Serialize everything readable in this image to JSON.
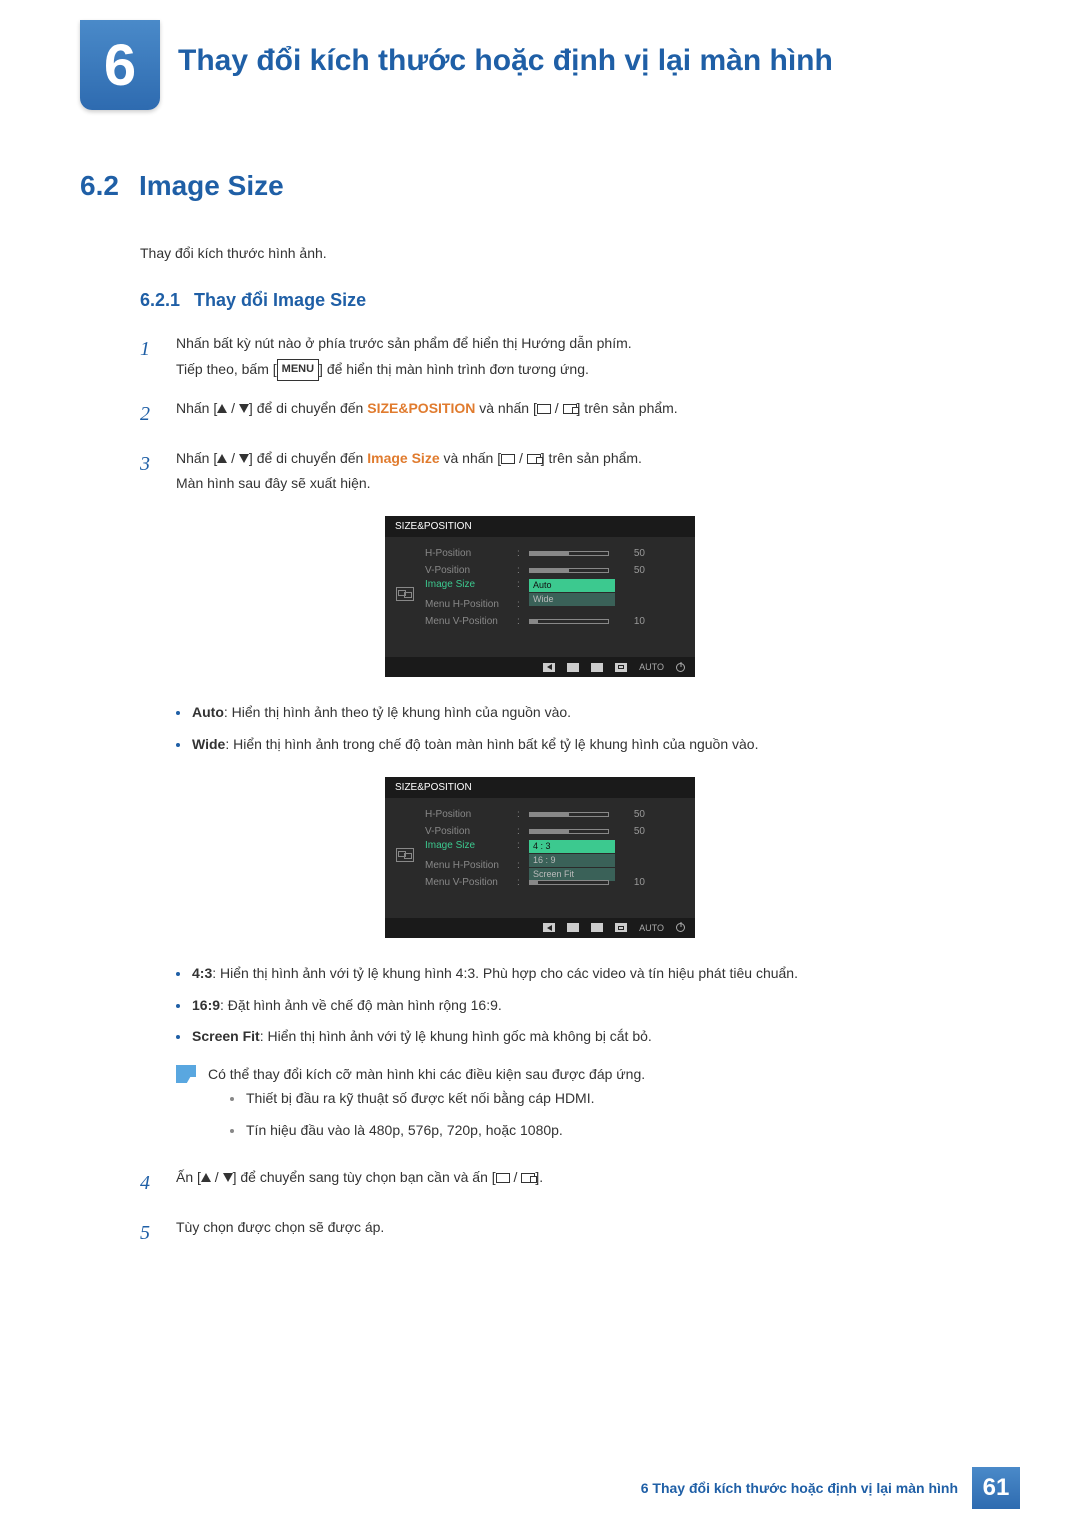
{
  "chapter": {
    "number": "6",
    "title": "Thay đổi kích thước hoặc định vị lại màn hình"
  },
  "section": {
    "number": "6.2",
    "title": "Image Size",
    "intro": "Thay đổi kích thước hình ảnh."
  },
  "subsection": {
    "number": "6.2.1",
    "title": "Thay đổi Image Size"
  },
  "steps": {
    "s1": {
      "num": "1",
      "line1_a": "Nhấn bất kỳ nút nào ở phía trước sản phẩm để hiển thị Hướng dẫn phím.",
      "line2_a": "Tiếp theo, bấm [",
      "menu": "MENU",
      "line2_b": "] để hiển thị màn hình trình đơn tương ứng."
    },
    "s2": {
      "num": "2",
      "a": "Nhấn [",
      "b": "] để di chuyển đến ",
      "kw": "SIZE&POSITION",
      "c": " và nhấn [",
      "d": "] trên sản phẩm."
    },
    "s3": {
      "num": "3",
      "a": "Nhấn [",
      "b": "] để di chuyển đến ",
      "kw": "Image Size",
      "c": " và nhấn [",
      "d": "] trên sản phẩm.",
      "line2": "Màn hình sau đây sẽ xuất hiện."
    },
    "s4": {
      "num": "4",
      "a": "Ấn [",
      "b": "] để chuyển sang tùy chọn bạn cần và ấn [",
      "c": "]."
    },
    "s5": {
      "num": "5",
      "text": "Tùy chọn được chọn sẽ được áp."
    }
  },
  "osd": {
    "title": "SIZE&POSITION",
    "rows": {
      "hpos": {
        "label": "H-Position",
        "val": "50"
      },
      "vpos": {
        "label": "V-Position",
        "val": "50"
      },
      "imgsize": {
        "label": "Image Size"
      },
      "mhpos": {
        "label": "Menu H-Position"
      },
      "mvpos": {
        "label": "Menu V-Position",
        "val": "10"
      }
    },
    "options1": {
      "a": "Auto",
      "b": "Wide"
    },
    "options2": {
      "a": "4 : 3",
      "b": "16 : 9",
      "c": "Screen Fit"
    },
    "nav_auto": "AUTO"
  },
  "bullets1": {
    "auto": {
      "label": "Auto",
      "text": ": Hiển thị hình ảnh theo tỷ lệ khung hình của nguồn vào."
    },
    "wide": {
      "label": "Wide",
      "text": ": Hiển thị hình ảnh trong chế độ toàn màn hình bất kể tỷ lệ khung hình của nguồn vào."
    }
  },
  "bullets2": {
    "b43": {
      "label": "4:3",
      "text": ": Hiển thị hình ảnh với tỷ lệ khung hình 4:3. Phù hợp cho các video và tín hiệu phát tiêu chuẩn."
    },
    "b169": {
      "label": "16:9",
      "text": ": Đặt hình ảnh về chế độ màn hình rộng 16:9."
    },
    "bfit": {
      "label": "Screen Fit",
      "text": ": Hiển thị hình ảnh với tỷ lệ khung hình gốc mà không bị cắt bỏ."
    }
  },
  "note": {
    "lead": "Có thể thay đổi kích cỡ màn hình khi các điều kiện sau được đáp ứng.",
    "i1": "Thiết bị đầu ra kỹ thuật số được kết nối bằng cáp HDMI.",
    "i2": "Tín hiệu đầu vào là 480p, 576p, 720p, hoặc 1080p."
  },
  "footer": {
    "chapter_ref": "6",
    "title": "Thay đổi kích thước hoặc định vị lại màn hình",
    "page": "61"
  }
}
